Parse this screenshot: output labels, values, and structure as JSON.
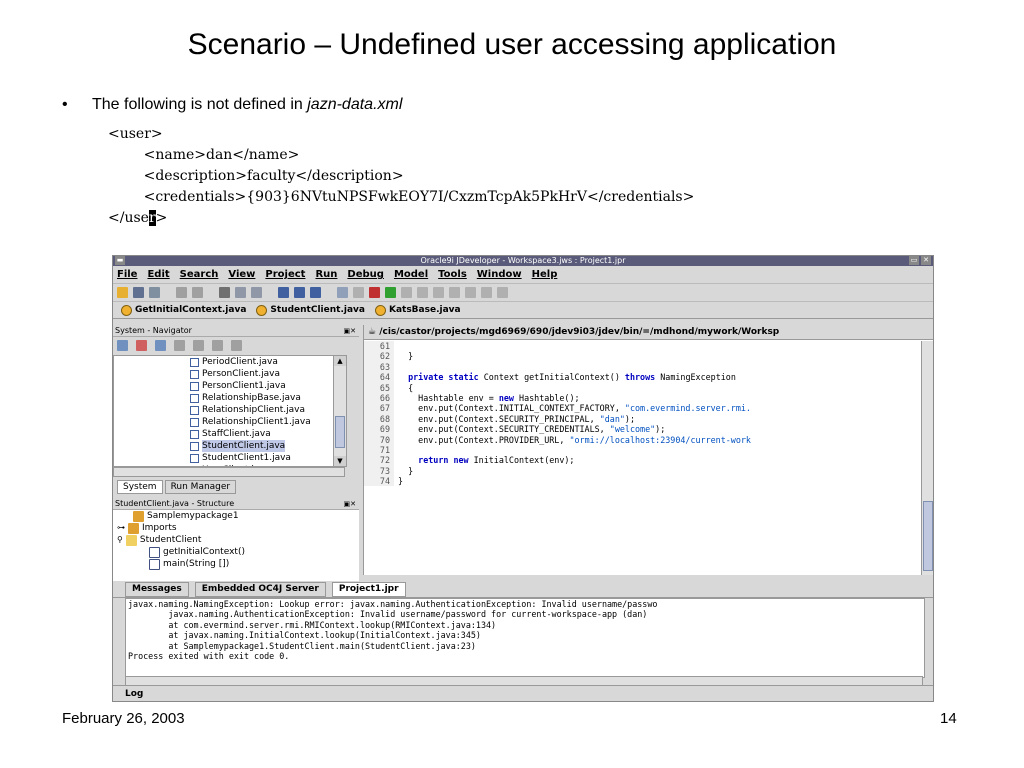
{
  "slide": {
    "title": "Scenario – Undefined user accessing application",
    "bullet_prefix": "The following is not defined in ",
    "bullet_italic": "jazn-data.xml",
    "xml_lines": [
      "<user>",
      "        <name>dan</name>",
      "        <description>faculty</description>",
      "        <credentials>{903}6NVtuNPSFwkEOY7I/CxzmTcpAk5PkHrV</credentials>"
    ],
    "xml_last_a": "</use",
    "xml_last_cursor": "r",
    "xml_last_b": ">",
    "date": "February 26, 2003",
    "page": "14"
  },
  "ide": {
    "window_title": "Oracle9i JDeveloper - Workspace3.jws : Project1.jpr",
    "menu": [
      "File",
      "Edit",
      "Search",
      "View",
      "Project",
      "Run",
      "Debug",
      "Model",
      "Tools",
      "Window",
      "Help"
    ],
    "doc_tabs": [
      "GetInitialContext.java",
      "StudentClient.java",
      "KatsBase.java"
    ],
    "navigator_title": "System - Navigator",
    "navigator_items": [
      {
        "label": "PeriodClient.java",
        "selected": false
      },
      {
        "label": "PersonClient.java",
        "selected": false
      },
      {
        "label": "PersonClient1.java",
        "selected": false
      },
      {
        "label": "RelationshipBase.java",
        "selected": false
      },
      {
        "label": "RelationshipClient.java",
        "selected": false
      },
      {
        "label": "RelationshipClient1.java",
        "selected": false
      },
      {
        "label": "StaffClient.java",
        "selected": false
      },
      {
        "label": "StudentClient.java",
        "selected": true
      },
      {
        "label": "StudentClient1.java",
        "selected": false
      },
      {
        "label": "UserClient.java",
        "selected": false
      }
    ],
    "navigator_tabs": [
      "System",
      "Run Manager"
    ],
    "structure_title": "StudentClient.java - Structure",
    "structure_items": [
      "Samplemypackage1",
      "Imports",
      "StudentClient",
      "getInitialContext()",
      "main(String [])"
    ],
    "editor_path": "/cis/castor/projects/mgd6969/690/jdev9i03/jdev/bin/=/mdhond/mywork/Worksp",
    "code_lines": [
      {
        "n": "61",
        "segs": [
          {
            "t": "",
            "c": ""
          }
        ]
      },
      {
        "n": "62",
        "segs": [
          {
            "t": "  }",
            "c": ""
          }
        ]
      },
      {
        "n": "63",
        "segs": [
          {
            "t": "",
            "c": ""
          }
        ]
      },
      {
        "n": "64",
        "segs": [
          {
            "t": "  ",
            "c": ""
          },
          {
            "t": "private static",
            "c": "kw"
          },
          {
            "t": " Context getInitialContext() ",
            "c": ""
          },
          {
            "t": "throws",
            "c": "kw"
          },
          {
            "t": " NamingException",
            "c": ""
          }
        ]
      },
      {
        "n": "65",
        "segs": [
          {
            "t": "  {",
            "c": ""
          }
        ]
      },
      {
        "n": "66",
        "segs": [
          {
            "t": "    Hashtable env = ",
            "c": ""
          },
          {
            "t": "new",
            "c": "kw"
          },
          {
            "t": " Hashtable();",
            "c": ""
          }
        ]
      },
      {
        "n": "67",
        "segs": [
          {
            "t": "    env.put(Context.INITIAL_CONTEXT_FACTORY, ",
            "c": ""
          },
          {
            "t": "\"com.evermind.server.rmi.",
            "c": "str"
          }
        ]
      },
      {
        "n": "68",
        "segs": [
          {
            "t": "    env.put(Context.SECURITY_PRINCIPAL, ",
            "c": ""
          },
          {
            "t": "\"dan\"",
            "c": "str"
          },
          {
            "t": ");",
            "c": ""
          }
        ]
      },
      {
        "n": "69",
        "segs": [
          {
            "t": "    env.put(Context.SECURITY_CREDENTIALS, ",
            "c": ""
          },
          {
            "t": "\"welcome\"",
            "c": "str"
          },
          {
            "t": ");",
            "c": ""
          }
        ]
      },
      {
        "n": "70",
        "segs": [
          {
            "t": "    env.put(Context.PROVIDER_URL, ",
            "c": ""
          },
          {
            "t": "\"ormi://localhost:23904/current-work",
            "c": "str"
          }
        ]
      },
      {
        "n": "71",
        "segs": [
          {
            "t": "",
            "c": ""
          }
        ]
      },
      {
        "n": "72",
        "segs": [
          {
            "t": "    ",
            "c": ""
          },
          {
            "t": "return new",
            "c": "kw"
          },
          {
            "t": " InitialContext(env);",
            "c": ""
          }
        ]
      },
      {
        "n": "73",
        "segs": [
          {
            "t": "  }",
            "c": ""
          }
        ]
      },
      {
        "n": "74",
        "segs": [
          {
            "t": "}",
            "c": ""
          }
        ]
      }
    ],
    "bottom_tabs": [
      "Messages",
      "Embedded OC4J Server",
      "Project1.jpr"
    ],
    "console_lines": [
      "javax.naming.NamingException: Lookup error: javax.naming.AuthenticationException: Invalid username/passwo",
      "        javax.naming.AuthenticationException: Invalid username/password for current-workspace-app (dan)",
      "        at com.evermind.server.rmi.RMIContext.lookup(RMIContext.java:134)",
      "        at javax.naming.InitialContext.lookup(InitialContext.java:345)",
      "        at Samplemypackage1.StudentClient.main(StudentClient.java:23)",
      "Process exited with exit code 0."
    ],
    "log_label": "Log"
  }
}
